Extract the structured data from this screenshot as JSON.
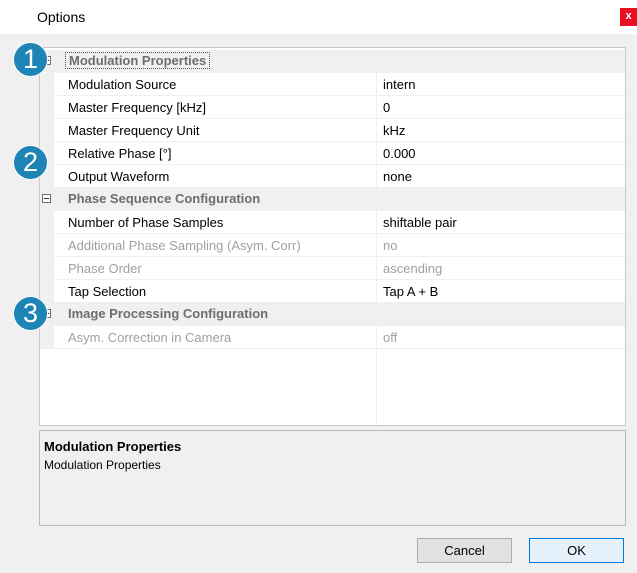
{
  "window": {
    "title": "Options",
    "close_label": "x"
  },
  "categories": [
    {
      "label": "Modulation Properties",
      "properties": [
        {
          "name": "Modulation Source",
          "value": "intern",
          "disabled": false
        },
        {
          "name": "Master Frequency [kHz]",
          "value": "0",
          "disabled": false
        },
        {
          "name": "Master Frequency Unit",
          "value": "kHz",
          "disabled": false
        },
        {
          "name": "Relative Phase [°]",
          "value": "0.000",
          "disabled": false
        },
        {
          "name": "Output Waveform",
          "value": "none",
          "disabled": false
        }
      ]
    },
    {
      "label": "Phase Sequence Configuration",
      "properties": [
        {
          "name": "Number of Phase Samples",
          "value": "shiftable pair",
          "disabled": false
        },
        {
          "name": "Additional Phase Sampling (Asym. Corr)",
          "value": "no",
          "disabled": true
        },
        {
          "name": "Phase Order",
          "value": "ascending",
          "disabled": true
        },
        {
          "name": "Tap Selection",
          "value": "Tap A + B",
          "disabled": false
        }
      ]
    },
    {
      "label": "Image Processing Configuration",
      "properties": [
        {
          "name": "Asym. Correction in Camera",
          "value": "off",
          "disabled": true
        }
      ]
    }
  ],
  "description": {
    "title": "Modulation Properties",
    "text": "Modulation Properties"
  },
  "buttons": {
    "cancel": "Cancel",
    "ok": "OK"
  },
  "badges": [
    "1",
    "2",
    "3"
  ],
  "colors": {
    "badge": "#1d84b5",
    "close": "#e81123",
    "disabled_text": "#a0a0a0"
  }
}
